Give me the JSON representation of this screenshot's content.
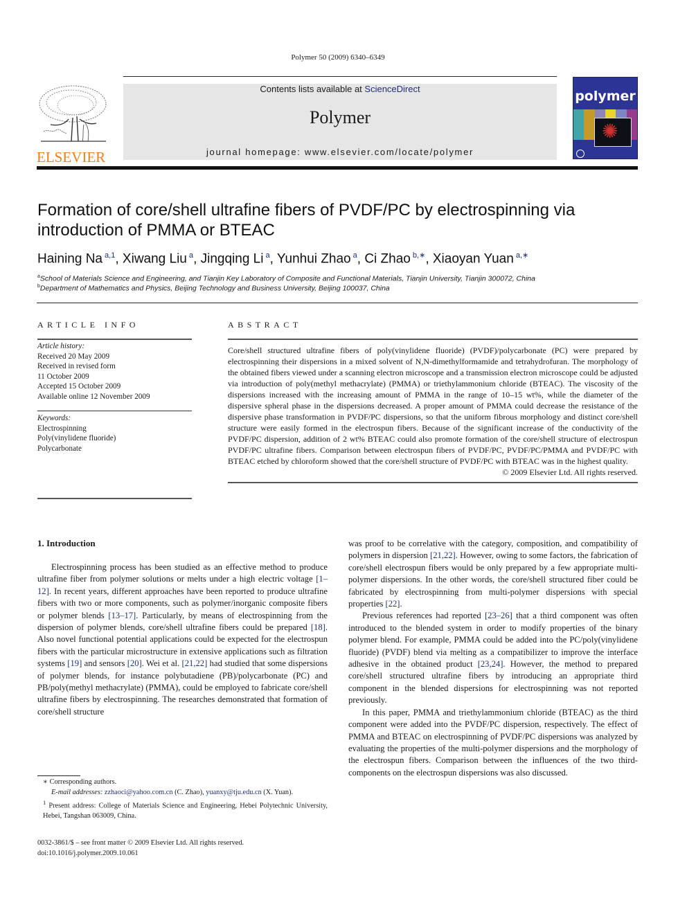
{
  "header": {
    "journal_ref": "Polymer 50 (2009) 6340–6349",
    "contents_prefix": "Contents lists available at ",
    "contents_link": "ScienceDirect",
    "journal_name": "Polymer",
    "homepage": "journal homepage: www.elsevier.com/locate/polymer",
    "publisher_logo_text": "ELSEVIER",
    "cover_title": "polymer",
    "colors": {
      "elsevier_orange": "#f07f1a",
      "link_blue": "#1f2e7a",
      "cover_blue": "#2c3595",
      "banner_gray": "#e6e6e6"
    }
  },
  "article": {
    "title": "Formation of core/shell ultrafine fibers of PVDF/PC by electrospinning via introduction of PMMA or BTEAC",
    "authors": [
      {
        "name": "Haining Na",
        "marks": "a,1"
      },
      {
        "name": "Xiwang Liu",
        "marks": "a"
      },
      {
        "name": "Jingqing Li",
        "marks": "a"
      },
      {
        "name": "Yunhui Zhao",
        "marks": "a"
      },
      {
        "name": "Ci Zhao",
        "marks": "b,∗"
      },
      {
        "name": "Xiaoyan Yuan",
        "marks": "a,∗"
      }
    ],
    "affiliations": [
      {
        "mark": "a",
        "text": "School of Materials Science and Engineering, and Tianjin Key Laboratory of Composite and Functional Materials, Tianjin University, Tianjin 300072, China"
      },
      {
        "mark": "b",
        "text": "Department of Mathematics and Physics, Beijing Technology and Business University, Beijing 100037, China"
      }
    ]
  },
  "article_info": {
    "heading": "ARTICLE INFO",
    "history_label": "Article history:",
    "history": [
      "Received 20 May 2009",
      "Received in revised form",
      "11 October 2009",
      "Accepted 15 October 2009",
      "Available online 12 November 2009"
    ],
    "keywords_label": "Keywords:",
    "keywords": [
      "Electrospinning",
      "Poly(vinylidene fluoride)",
      "Polycarbonate"
    ]
  },
  "abstract": {
    "heading": "ABSTRACT",
    "text": "Core/shell structured ultrafine fibers of poly(vinylidene fluoride) (PVDF)/polycarbonate (PC) were prepared by electrospinning their dispersions in a mixed solvent of N,N-dimethylformamide and tetrahydrofuran. The morphology of the obtained fibers viewed under a scanning electron microscope and a transmission electron microscope could be adjusted via introduction of poly(methyl methacrylate) (PMMA) or triethylammonium chloride (BTEAC). The viscosity of the dispersions increased with the increasing amount of PMMA in the range of 10–15 wt%, while the diameter of the dispersive spheral phase in the dispersions decreased. A proper amount of PMMA could decrease the resistance of the dispersive phase transformation in PVDF/PC dispersions, so that the uniform fibrous morphology and distinct core/shell structure were easily formed in the electrospun fibers. Because of the significant increase of the conductivity of the PVDF/PC dispersion, addition of 2 wt% BTEAC could also promote formation of the core/shell structure of electrospun PVDF/PC ultrafine fibers. Comparison between electrospun fibers of PVDF/PC, PVDF/PC/PMMA and PVDF/PC with BTEAC etched by chloroform showed that the core/shell structure of PVDF/PC with BTEAC was in the highest quality.",
    "copyright": "© 2009 Elsevier Ltd. All rights reserved."
  },
  "introduction": {
    "heading": "1.  Introduction",
    "left_paragraph": [
      {
        "t": "Electrospinning process has been studied as an effective method to produce ultrafine fiber from polymer solutions or melts under a high electric voltage "
      },
      {
        "ref": "[1–12]"
      },
      {
        "t": ". In recent years, different approaches have been reported to produce ultrafine fibers with two or more components, such as polymer/inorganic composite fibers or polymer blends "
      },
      {
        "ref": "[13–17]"
      },
      {
        "t": ". Particularly, by means of electrospinning from the dispersion of polymer blends, core/shell ultrafine fibers could be prepared "
      },
      {
        "ref": "[18]"
      },
      {
        "t": ". Also novel functional potential applications could be expected for the electrospun fibers with the particular microstructure in extensive applications such as filtration systems "
      },
      {
        "ref": "[19]"
      },
      {
        "t": " and sensors "
      },
      {
        "ref": "[20]"
      },
      {
        "t": ". Wei et al. "
      },
      {
        "ref": "[21,22]"
      },
      {
        "t": " had studied that some dispersions of polymer blends, for instance polybutadiene (PB)/polycarbonate (PC) and PB/poly(methyl methacrylate) (PMMA), could be employed to fabricate core/shell ultrafine fibers by electrospinning. The researches demonstrated that formation of core/shell structure"
      }
    ],
    "right_paragraph_1": [
      {
        "t": "was proof to be correlative with the category, composition, and compatibility of polymers in dispersion "
      },
      {
        "ref": "[21,22]"
      },
      {
        "t": ". However, owing to some factors, the fabrication of core/shell electrospun fibers would be only prepared by a few appropriate multi-polymer dispersions. In the other words, the core/shell structured fiber could be fabricated by electrospinning from multi-polymer dispersions with special properties "
      },
      {
        "ref": "[22]"
      },
      {
        "t": "."
      }
    ],
    "right_paragraph_2": [
      {
        "t": "Previous references had reported "
      },
      {
        "ref": "[23–26]"
      },
      {
        "t": " that a third component was often introduced to the blended system in order to modify properties of the binary polymer blend. For example, PMMA could be added into the PC/poly(vinylidene fluoride) (PVDF) blend via melting as a compatibilizer to improve the interface adhesive in the obtained product "
      },
      {
        "ref": "[23,24]"
      },
      {
        "t": ". However, the method to prepared core/shell structured ultrafine fibers by introducing an appropriate third component in the blended dispersions for electrospinning was not reported previously."
      }
    ],
    "right_paragraph_3": "In this paper, PMMA and triethylammonium chloride (BTEAC) as the third component were added into the PVDF/PC dispersion, respectively. The effect of PMMA and BTEAC on electrospinning of PVDF/PC dispersions was analyzed by evaluating the properties of the multi-polymer dispersions and the morphology of the electrospun fibers. Comparison between the influences of the two third-components on the electrospun dispersions was also discussed."
  },
  "footnotes": {
    "corresponding": "∗  Corresponding authors.",
    "email_label": "E-mail addresses:",
    "email_1": "zzhaoci@yahoo.com.cn",
    "email_1_who": " (C. Zhao), ",
    "email_2": "yuanxy@tju.edu.cn",
    "email_2_who": " (X. Yuan).",
    "present_mark": "1",
    "present_address": " Present address: College of Materials Science and Engineering, Hebei Polytechnic University, Hebei, Tangshan 063009, China."
  },
  "front_matter": {
    "issn_line": "0032-3861/$ – see front matter © 2009 Elsevier Ltd. All rights reserved.",
    "doi": "doi:10.1016/j.polymer.2009.10.061"
  }
}
